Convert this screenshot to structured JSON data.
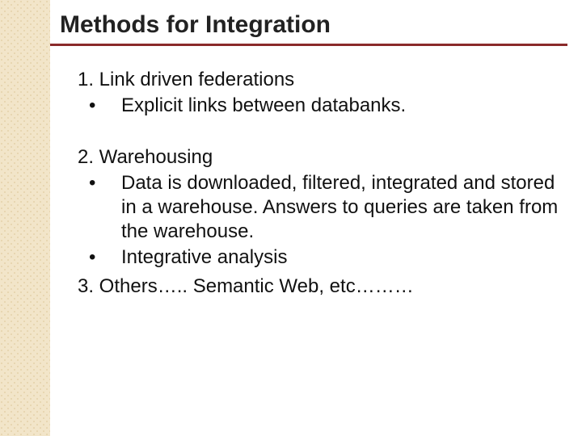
{
  "title": "Methods for Integration",
  "items": {
    "n1": "1. Link driven federations",
    "n1b1": "Explicit links between databanks.",
    "n2": "2. Warehousing",
    "n2b1": "Data is downloaded, filtered, integrated and stored in a warehouse. Answers to queries are taken from the warehouse.",
    "n2b2": "Integrative analysis",
    "n3": "3. Others….. Semantic Web, etc………"
  },
  "bullet": "•"
}
